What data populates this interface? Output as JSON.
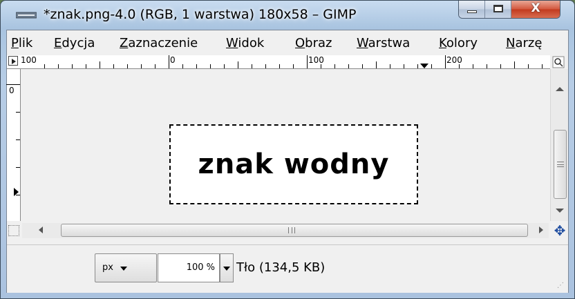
{
  "window": {
    "title": "*znak.png-4.0 (RGB, 1 warstwa) 180x58 – GIMP",
    "app_icon": "gimp-window-icon",
    "minimize_label": "",
    "maximize_label": "",
    "close_label": "X"
  },
  "menu": {
    "items": [
      {
        "label": "Plik"
      },
      {
        "label": "Edycja"
      },
      {
        "label": "Zaznaczenie"
      },
      {
        "label": "Widok"
      },
      {
        "label": "Obraz"
      },
      {
        "label": "Warstwa"
      },
      {
        "label": "Kolory"
      },
      {
        "label": "Narzę"
      }
    ]
  },
  "ruler": {
    "horizontal_labels": [
      "100",
      "0",
      "100",
      "200"
    ],
    "vertical_labels": [
      "0"
    ],
    "unit": "px"
  },
  "canvas": {
    "image_text": "znak wodny",
    "image_size": "180x58"
  },
  "scrollbar": {
    "horizontal_grip": "III",
    "vertical_grip": "≡"
  },
  "status": {
    "unit": "px",
    "zoom": "100 %",
    "info": "Tło (134,5 KB)"
  },
  "icons": {
    "navigate": "navigate-icon",
    "zoom_toggle": "zoom-toggle-icon",
    "quick_mask": "quick-mask-icon",
    "move": "move-icon"
  }
}
